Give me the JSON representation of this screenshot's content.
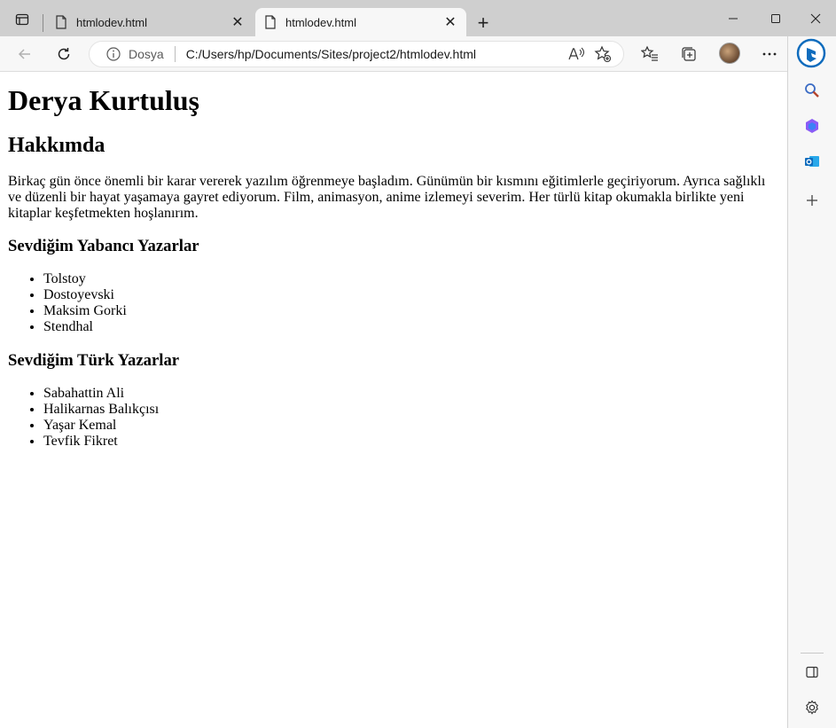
{
  "browser": {
    "tabs": [
      {
        "title": "htmlodev.html",
        "active": false
      },
      {
        "title": "htmlodev.html",
        "active": true
      }
    ],
    "address": {
      "site_label": "Dosya",
      "url": "C:/Users/hp/Documents/Sites/project2/htmlodev.html"
    },
    "colors": {
      "tabstrip": "#cfcfcf",
      "toolbar": "#f7f7f7",
      "accent": "#0f6cbd"
    },
    "icons": {
      "tab_actions": "tab-actions-icon",
      "back": "back-arrow-icon",
      "refresh": "refresh-icon",
      "read_aloud": "read-aloud-icon",
      "add_favorite": "add-favorite-icon",
      "favorites": "favorites-icon",
      "collections": "collections-icon",
      "more": "more-icon",
      "bing": "bing-icon"
    }
  },
  "sidebar": {
    "items": [
      "search-icon",
      "office-icon",
      "outlook-icon",
      "add-icon"
    ],
    "bottom": [
      "hide-sidebar-icon",
      "settings-icon"
    ]
  },
  "page": {
    "title": "Derya Kurtuluş",
    "about_heading": "Hakkımda",
    "about_text": "Birkaç gün önce önemli bir karar vererek yazılım öğrenmeye başladım. Günümün bir kısmını eğitimlerle geçiriyorum. Ayrıca sağlıklı ve düzenli bir hayat yaşamaya gayret ediyorum. Film, animasyon, anime izlemeyi severim. Her türlü kitap okumakla birlikte yeni kitaplar keşfetmekten hoşlanırım.",
    "foreign_heading": "Sevdiğim Yabancı Yazarlar",
    "foreign_authors": [
      "Tolstoy",
      "Dostoyevski",
      "Maksim Gorki",
      "Stendhal"
    ],
    "turkish_heading": "Sevdiğim Türk Yazarlar",
    "turkish_authors": [
      "Sabahattin Ali",
      "Halikarnas Balıkçısı",
      "Yaşar Kemal",
      "Tevfik Fikret"
    ]
  }
}
